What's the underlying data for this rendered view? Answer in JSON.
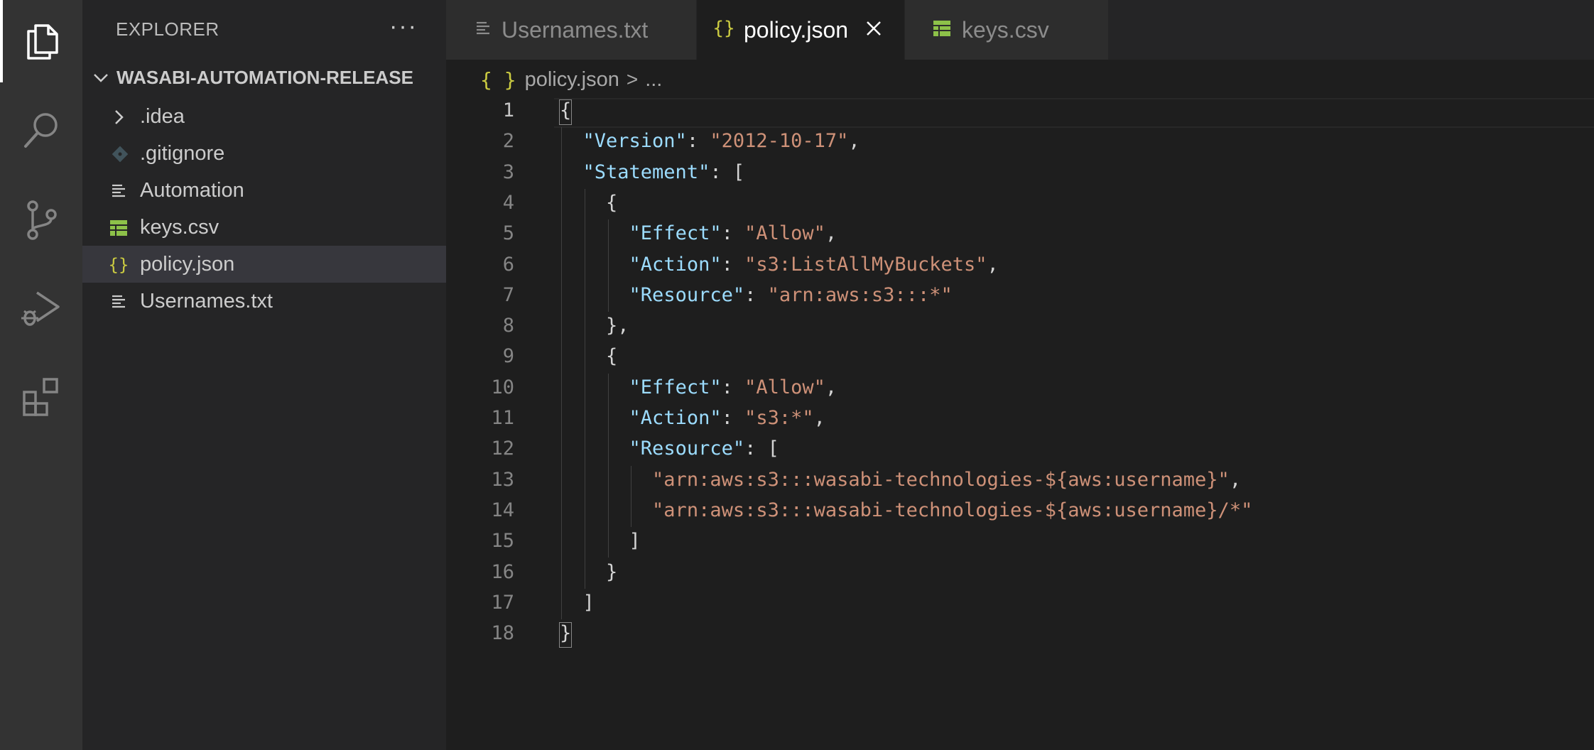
{
  "sidebar": {
    "title": "EXPLORER",
    "more": "···",
    "folder": "WASABI-AUTOMATION-RELEASE",
    "items": [
      {
        "label": ".idea",
        "icon": "chevron-right-icon"
      },
      {
        "label": ".gitignore",
        "icon": "git-icon"
      },
      {
        "label": "Automation",
        "icon": "text-file-icon"
      },
      {
        "label": "keys.csv",
        "icon": "csv-icon"
      },
      {
        "label": "policy.json",
        "icon": "json-icon"
      },
      {
        "label": "Usernames.txt",
        "icon": "text-file-icon"
      }
    ],
    "selected": "policy.json"
  },
  "tabs": [
    {
      "label": "Usernames.txt",
      "icon": "text-file-icon"
    },
    {
      "label": "policy.json",
      "icon": "json-icon",
      "active": true
    },
    {
      "label": "keys.csv",
      "icon": "csv-icon"
    }
  ],
  "breadcrumb": {
    "icon": "{ }",
    "file": "policy.json",
    "sep": ">",
    "more": "..."
  },
  "editor": {
    "line_numbers": [
      "1",
      "2",
      "3",
      "4",
      "5",
      "6",
      "7",
      "8",
      "9",
      "10",
      "11",
      "12",
      "13",
      "14",
      "15",
      "16",
      "17",
      "18"
    ],
    "active_line": "1",
    "lines": [
      "{",
      "  \"Version\": \"2012-10-17\",",
      "  \"Statement\": [",
      "    {",
      "      \"Effect\": \"Allow\",",
      "      \"Action\": \"s3:ListAllMyBuckets\",",
      "      \"Resource\": \"arn:aws:s3:::*\"",
      "    },",
      "    {",
      "      \"Effect\": \"Allow\",",
      "      \"Action\": \"s3:*\",",
      "      \"Resource\": [",
      "        \"arn:aws:s3:::wasabi-technologies-${aws:username}\",",
      "        \"arn:aws:s3:::wasabi-technologies-${aws:username}/*\"",
      "      ]",
      "    }",
      "  ]",
      "}"
    ]
  },
  "colors": {
    "json_key": "#9cdcfe",
    "json_string": "#ce9178",
    "json_icon": "#cbcb41",
    "csv_icon": "#8dc149",
    "git_icon": "#41535b"
  }
}
